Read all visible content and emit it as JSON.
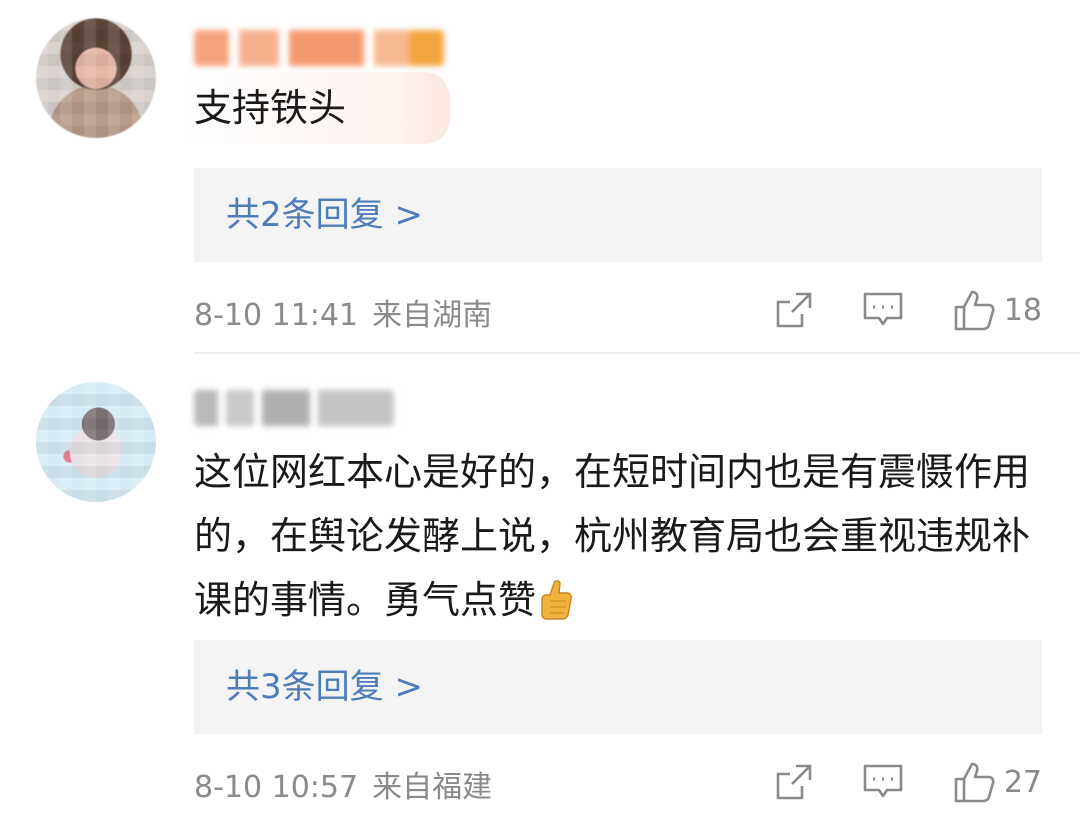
{
  "comments": [
    {
      "text": "支持铁头",
      "replies_label": "共2条回复 >",
      "timestamp": "8-10 11:41",
      "location": "来自湖南",
      "like_count": "18",
      "avatar_icon": "avatar-blurred",
      "username_blurred": true
    },
    {
      "text": "这位网红本心是好的，在短时间内也是有震慑作用的，在舆论发酵上说，杭州教育局也会重视违规补课的事情。勇气点赞",
      "emoji_icon": "thumbs-up-emoji",
      "replies_label": "共3条回复 >",
      "timestamp": "8-10 10:57",
      "location": "来自福建",
      "like_count": "27",
      "avatar_icon": "avatar-blurred",
      "username_blurred": true
    }
  ],
  "icons": {
    "share": "share-icon",
    "comment": "comment-icon",
    "like": "thumbs-up-icon"
  },
  "colors": {
    "reply_link": "#4e7cb8",
    "meta_text": "#8a8a8a",
    "reply_background": "#f4f4f4"
  }
}
